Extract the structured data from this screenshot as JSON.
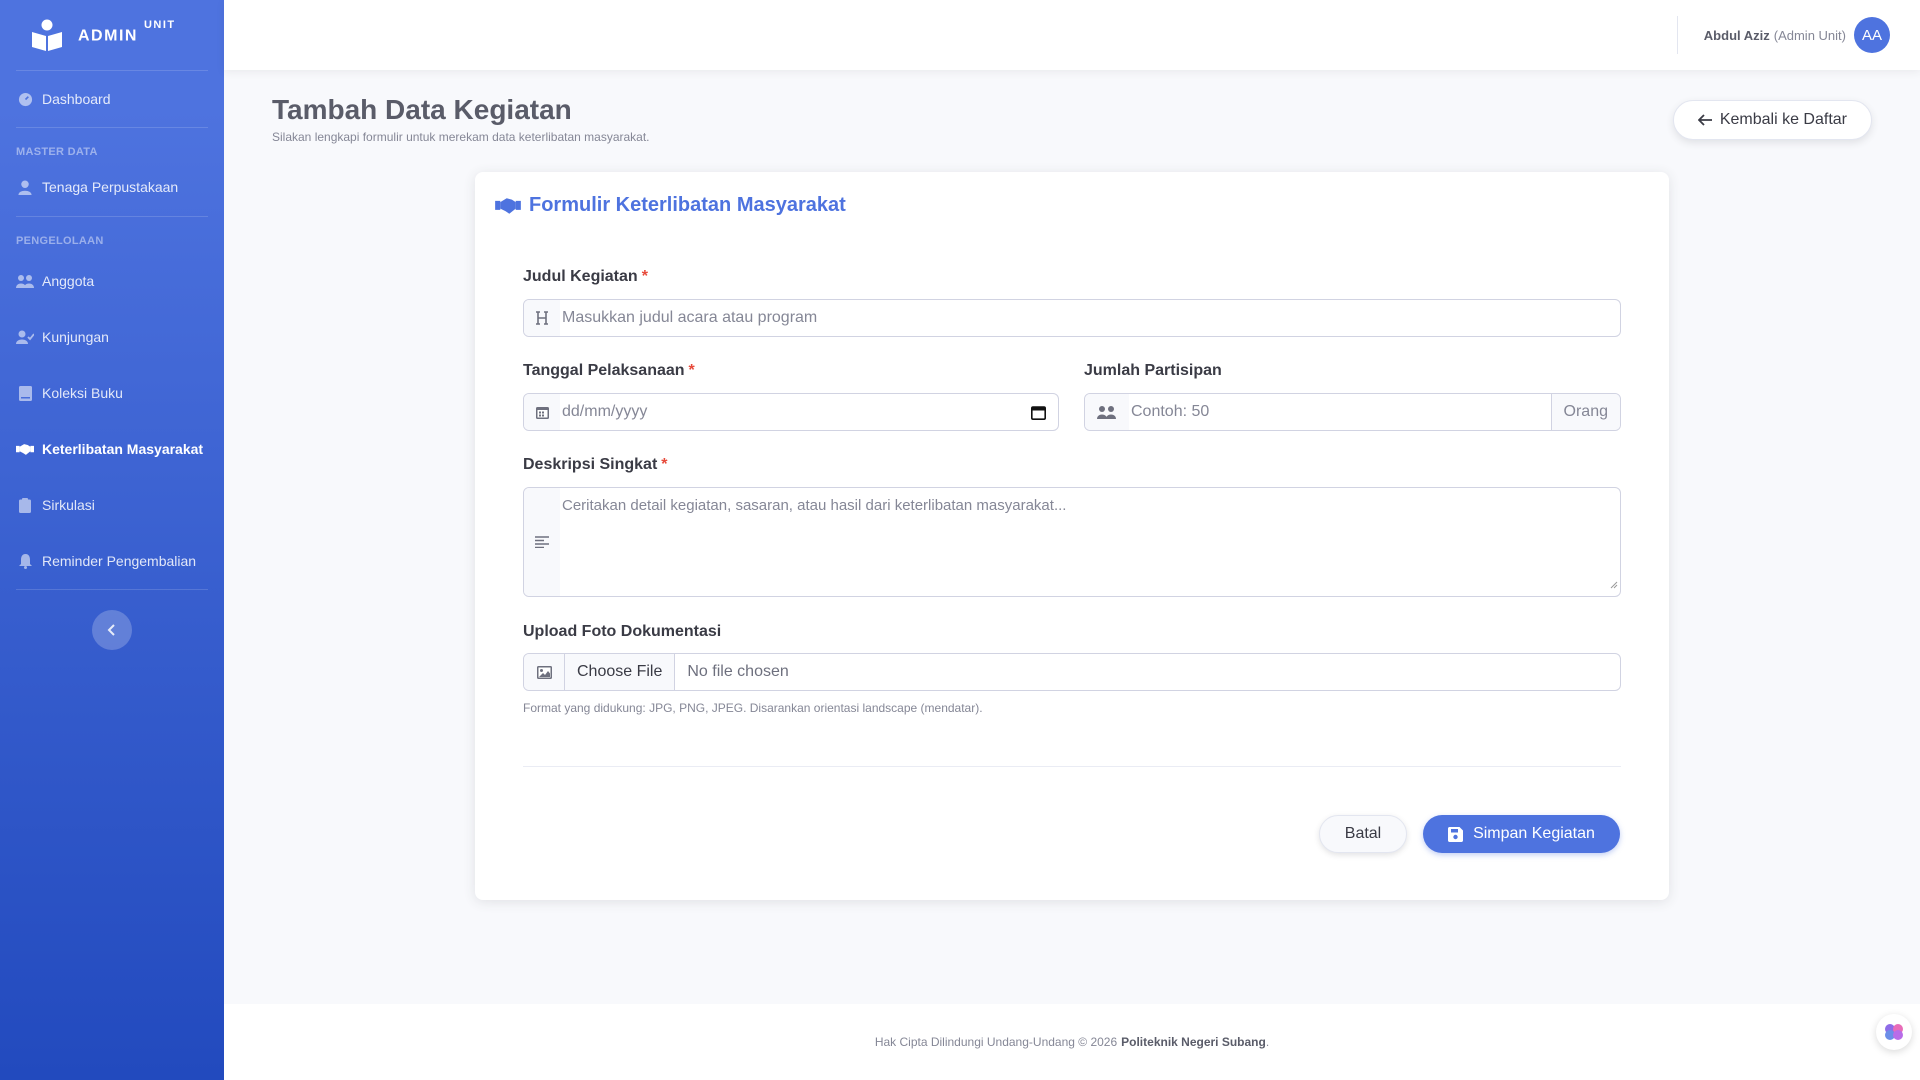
{
  "brand": {
    "name": "ADMIN",
    "sup": "UNIT"
  },
  "sidebar": {
    "dashboard": "Dashboard",
    "heading_master": "MASTER DATA",
    "tenaga": "Tenaga Perpustakaan",
    "heading_pengelolaan": "PENGELOLAAN",
    "items": [
      {
        "label": "Anggota",
        "icon": "users-icon"
      },
      {
        "label": "Kunjungan",
        "icon": "user-check-icon"
      },
      {
        "label": "Koleksi Buku",
        "icon": "book-icon"
      },
      {
        "label": "Keterlibatan Masyarakat",
        "icon": "handshake-icon",
        "active": true
      },
      {
        "label": "Sirkulasi",
        "icon": "clipboard-icon"
      },
      {
        "label": "Reminder Pengembalian",
        "icon": "bell-icon"
      }
    ]
  },
  "topbar": {
    "user_name": "Abdul Aziz",
    "user_role": "(Admin Unit)",
    "avatar_initials": "AA"
  },
  "page": {
    "title": "Tambah Data Kegiatan",
    "subtitle": "Silakan lengkapi formulir untuk merekam data keterlibatan masyarakat.",
    "back_label": "Kembali ke Daftar"
  },
  "form": {
    "card_title": "Formulir Keterlibatan Masyarakat",
    "judul_label": "Judul Kegiatan",
    "judul_placeholder": "Masukkan judul acara atau program",
    "tanggal_label": "Tanggal Pelaksanaan",
    "tanggal_placeholder": "dd/mm/yyyy",
    "jumlah_label": "Jumlah Partisipan",
    "jumlah_placeholder": "Contoh: 50",
    "jumlah_suffix": "Orang",
    "deskripsi_label": "Deskripsi Singkat",
    "deskripsi_placeholder": "Ceritakan detail kegiatan, sasaran, atau hasil dari keterlibatan masyarakat...",
    "upload_label": "Upload Foto Dokumentasi",
    "choose_file": "Choose File",
    "no_file": "No file chosen",
    "upload_help": "Format yang didukung: JPG, PNG, JPEG. Disarankan orientasi landscape (mendatar).",
    "required_mark": "*",
    "batal_label": "Batal",
    "simpan_label": "Simpan Kegiatan"
  },
  "footer": {
    "text": "Hak Cipta Dilindungi Undang-Undang © 2026",
    "org": "Politeknik Negeri Subang",
    "end": "."
  },
  "colors": {
    "primary": "#4e73df",
    "danger": "#e74a3b",
    "sidebar_end": "#224abe"
  }
}
